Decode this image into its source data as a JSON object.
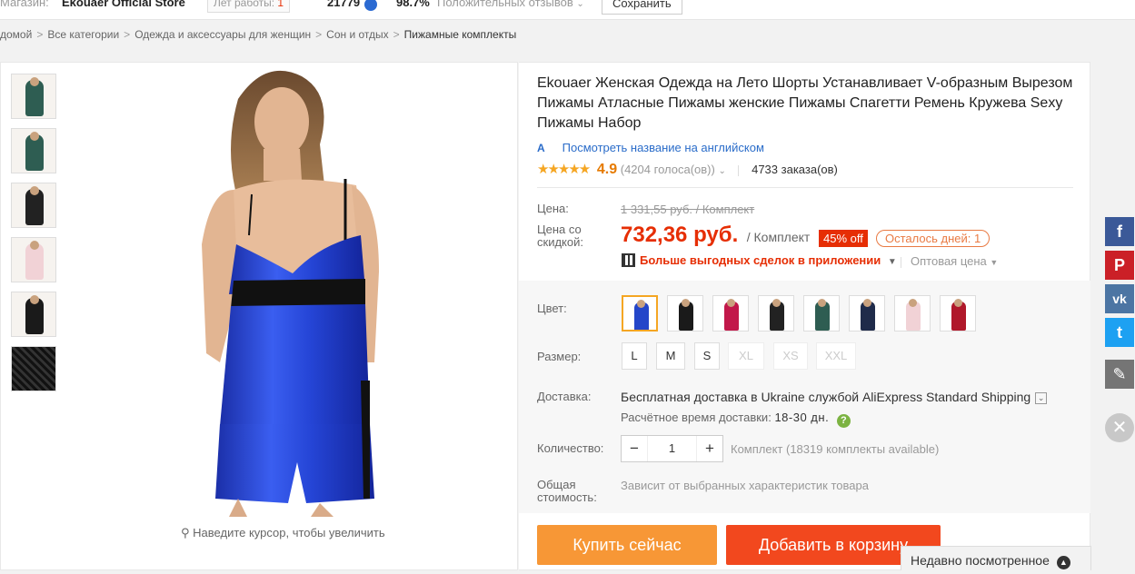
{
  "store": {
    "label": "Магазин:",
    "name": "Ekouaer Official Store",
    "years_label": "Лет работы:",
    "years_value": "1",
    "followers": "21779",
    "positive_pct": "98.7%",
    "positive_label": "Положительных отзывов",
    "save_label": "Сохранить"
  },
  "breadcrumb": [
    "домой",
    "Все категории",
    "Одежда и аксессуары для женщин",
    "Сон и отдых",
    "Пижамные комплекты"
  ],
  "product": {
    "title": "Ekouaer Женская Одежда на Лето Шорты Устанавливает V-образным Вырезом Пижамы Атласные Пижамы женские Пижамы Спагетти Ремень Кружева Sexy Пижамы Набор",
    "translate_icon": "A",
    "translate_label": "Посмотреть название на английском",
    "stars": "★★★★★",
    "rating": "4.9",
    "votes": "(4204 голоса(ов))",
    "orders": "4733 заказа(ов)",
    "zoom_hint": "Наведите курсор, чтобы увеличить"
  },
  "pricing": {
    "price_label": "Цена:",
    "old_price": "1 331,55 руб. / Комплект",
    "discount_label": "Цена со скидкой:",
    "price": "732,36 руб.",
    "unit": "/ Комплект",
    "off": "45% off",
    "days_left": "Осталось дней: 1",
    "app_deals": "Больше выгодных сделок в приложении",
    "wholesale": "Оптовая цена"
  },
  "options": {
    "color_label": "Цвет:",
    "colors": [
      "#2446c9",
      "#1a1a1a",
      "#c2184a",
      "#222222",
      "#2e5d52",
      "#1f2b4a",
      "#f1d2d6",
      "#b0182a"
    ],
    "size_label": "Размер:",
    "sizes": [
      {
        "label": "L",
        "enabled": true
      },
      {
        "label": "M",
        "enabled": true
      },
      {
        "label": "S",
        "enabled": true
      },
      {
        "label": "XL",
        "enabled": false
      },
      {
        "label": "XS",
        "enabled": false
      },
      {
        "label": "XXL",
        "enabled": false
      }
    ],
    "shipping_label": "Доставка:",
    "shipping": "Бесплатная доставка в Ukraine службой AliExpress Standard Shipping",
    "ship_time_label": "Расчётное время доставки:",
    "ship_time": "18-30 дн.",
    "qty_label": "Количество:",
    "qty": "1",
    "qty_note": "Комплект (18319 комплекты available)",
    "total_label": "Общая стоимость:",
    "total_note": "Зависит от выбранных характеристик товара"
  },
  "actions": {
    "buy_now": "Купить сейчас",
    "add_cart": "Добавить в корзину",
    "recently_viewed": "Недавно посмотренное"
  },
  "social": [
    {
      "name": "facebook",
      "glyph": "f",
      "color": "#3b5998"
    },
    {
      "name": "pinterest",
      "glyph": "P",
      "color": "#cb2027"
    },
    {
      "name": "vk",
      "glyph": "vk",
      "color": "#4c75a3"
    },
    {
      "name": "twitter",
      "glyph": "t",
      "color": "#1da1f2"
    },
    {
      "name": "edit",
      "glyph": "✎",
      "color": "#757575"
    }
  ],
  "colors": {
    "accent_red": "#e62e04",
    "buy_orange": "#f79736",
    "cart_red": "#f2481e",
    "link_blue": "#2a6cc9"
  }
}
